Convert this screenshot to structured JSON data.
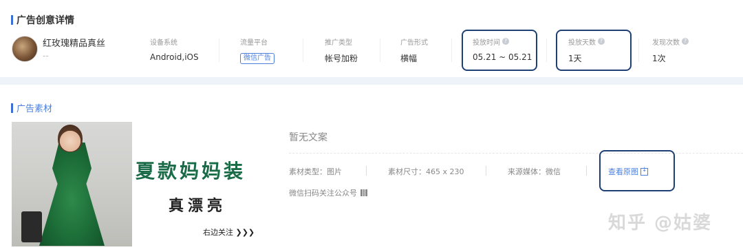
{
  "header": {
    "title": "广告创意详情"
  },
  "advertiser": {
    "name": "红玫瑰精品真丝",
    "subtitle": "--"
  },
  "meta": {
    "device": {
      "label": "设备系统",
      "value": "Android,iOS"
    },
    "platform": {
      "label": "流量平台",
      "value": "微信广告"
    },
    "promo_type": {
      "label": "推广类型",
      "value": "帐号加粉"
    },
    "ad_format": {
      "label": "广告形式",
      "value": "横幅"
    },
    "run_time": {
      "label": "投放时间",
      "value": "05.21 ~ 05.21"
    },
    "run_days": {
      "label": "投放天数",
      "value": "1天"
    },
    "discover_count": {
      "label": "发现次数",
      "value": "1次"
    }
  },
  "material": {
    "title": "广告素材",
    "image": {
      "headline": "夏款妈妈装",
      "subline": "真漂亮",
      "follow": "右边关注 ❯❯❯"
    },
    "no_copy": "暂无文案",
    "type": "素材类型：图片",
    "size": "素材尺寸：465 x 230",
    "source": "来源媒体：微信",
    "view_original": "查看原图",
    "wechat_scan": "微信扫码关注公众号"
  },
  "watermark": "知乎 @姑婆",
  "colors": {
    "accent": "#4a7fe0",
    "highlight_box": "#1d3f73",
    "ad_green": "#1a6b47"
  }
}
